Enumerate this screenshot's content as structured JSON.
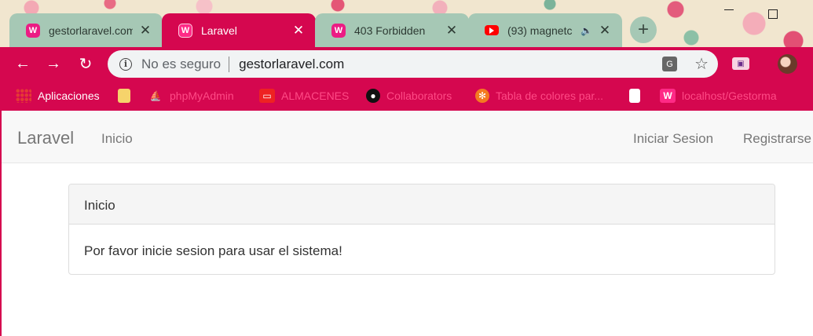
{
  "tabs": [
    {
      "title": "gestorlaravel.com",
      "favicon": "wampserver-icon",
      "close": "✕",
      "active": false
    },
    {
      "title": "Laravel",
      "favicon": "wampserver-icon",
      "close": "✕",
      "active": true
    },
    {
      "title": "403 Forbidden",
      "favicon": "wampserver-icon",
      "close": "✕",
      "active": false
    },
    {
      "title": "(93) magnetc",
      "favicon": "youtube-icon",
      "close": "✕",
      "active": false
    }
  ],
  "new_tab": "+",
  "toolbar": {
    "back": "←",
    "forward": "→",
    "reload": "↻",
    "info": "i",
    "security": "No es seguro",
    "url": "gestorlaravel.com",
    "star": "☆"
  },
  "bookmarks": [
    {
      "label": "Aplicaciones",
      "icon": "apps-grid-icon"
    },
    {
      "label": "",
      "icon": "folder-icon"
    },
    {
      "label": "phpMyAdmin",
      "icon": "phpmyadmin-icon"
    },
    {
      "label": "ALMACENES",
      "icon": "oracle-icon"
    },
    {
      "label": "Collaborators",
      "icon": "github-icon"
    },
    {
      "label": "Tabla de colores par...",
      "icon": "palette-icon"
    },
    {
      "label": "",
      "icon": "document-icon"
    },
    {
      "label": "localhost/Gestorma",
      "icon": "wampserver-icon"
    }
  ],
  "app": {
    "brand": "Laravel",
    "nav_home": "Inicio",
    "login": "Iniciar Sesion",
    "register": "Registrarse"
  },
  "panel": {
    "heading": "Inicio",
    "body": "Por favor inicie sesion para usar el sistema!"
  },
  "colors": {
    "theme_accent": "#d5074f",
    "inactive_tab": "#a6c8b5"
  }
}
